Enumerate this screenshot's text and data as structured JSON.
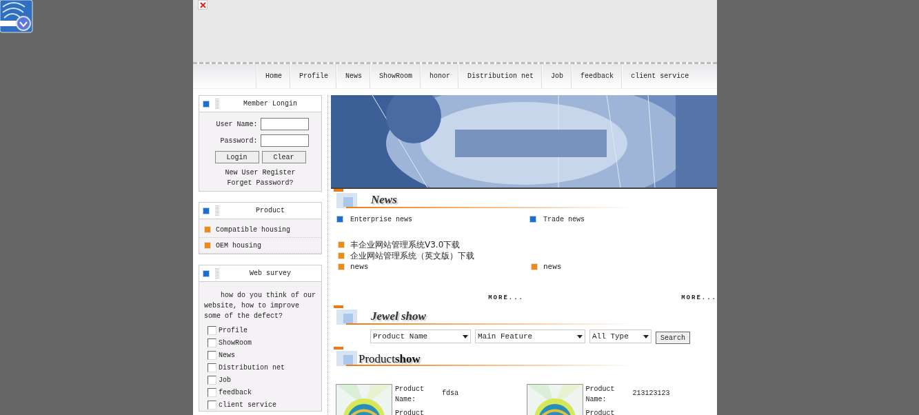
{
  "nav": [
    "Home",
    "Profile",
    "News",
    "ShowRoom",
    "honor",
    "Distribution net",
    "Job",
    "feedback",
    "client service"
  ],
  "login": {
    "title": "Member Longin",
    "fields": [
      {
        "label": "User Name:"
      },
      {
        "label": "Password:"
      }
    ],
    "buttons": [
      "Login",
      "Clear"
    ],
    "links": [
      "New User Register",
      "Forget Password?"
    ]
  },
  "product": {
    "title": "Product",
    "items": [
      "Compatible housing",
      "OEM housing"
    ]
  },
  "survey": {
    "title": "Web survey",
    "question": "how do you think of our website, how to improve some of the defect?",
    "options": [
      {
        "label": "Profile",
        "checked": false
      },
      {
        "label": "ShowRoom",
        "checked": false
      },
      {
        "label": "News",
        "checked": false
      },
      {
        "label": "Distribution net",
        "checked": false
      },
      {
        "label": "Job",
        "checked": false
      },
      {
        "label": "feedback",
        "checked": false
      },
      {
        "label": "client service",
        "checked": false
      }
    ]
  },
  "news": {
    "heading": "News",
    "categories": [
      {
        "title": "Enterprise news",
        "items": [
          "丰企业网站管理系统V3.0下载",
          "企业网站管理系统（英文版）下载",
          "news"
        ],
        "more": "MORE..."
      },
      {
        "title": "Trade news",
        "items": [
          "news"
        ],
        "more": "MORE..."
      }
    ]
  },
  "jewel": {
    "heading": "Jewel show",
    "selects": [
      "Product Name",
      "Main Feature",
      "All Type"
    ],
    "button": "Search"
  },
  "products": {
    "heading": "Product**show**",
    "items": [
      {
        "label": "Product Name:",
        "value": "fdsa",
        "label_2": "Product"
      },
      {
        "label": "Product Name:",
        "value": "213123123",
        "label_2": "Product"
      }
    ]
  }
}
